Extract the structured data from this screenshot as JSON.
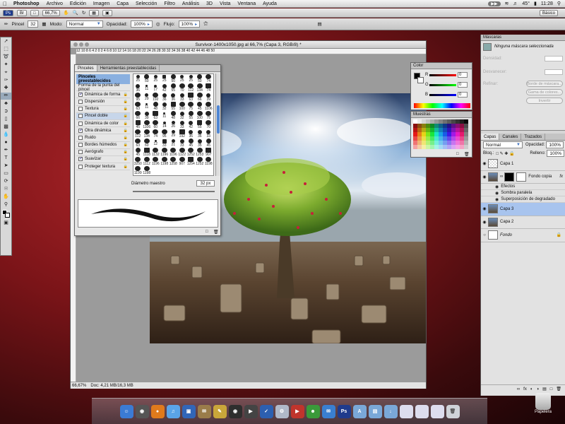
{
  "menubar": {
    "app": "Photoshop",
    "items": [
      "Archivo",
      "Edición",
      "Imagen",
      "Capa",
      "Selección",
      "Filtro",
      "Análisis",
      "3D",
      "Vista",
      "Ventana",
      "Ayuda"
    ],
    "battery": "45°",
    "clock": "11:28"
  },
  "appbar": {
    "zoom": "66,7%",
    "workspace": "Básico"
  },
  "options": {
    "tool": "Pincel",
    "brush_size": "32",
    "mode_label": "Modo:",
    "mode_value": "Normal",
    "opacity_label": "Opacidad:",
    "opacity_value": "100%",
    "flow_label": "Flujo:",
    "flow_value": "100%"
  },
  "document": {
    "title": "Survivor-1400x1050.jpg al 66,7% (Capa 3, RGB/8) *",
    "ruler_h": "12 10 8 6 4 2 0 2 4 6 8 10 12 14 16 18 20 22 24 26 28 30 32 34 36 38 40 42 44 46 48 50",
    "status_zoom": "66,67%",
    "status_doc": "Doc: 4,21 MB/16,3 MB"
  },
  "brushes": {
    "tabs": [
      "Pinceles",
      "Herramientas preestablecidas"
    ],
    "preset_button": "Pinceles preestablecidos",
    "tip_shape": "Forma de la punta del pincel",
    "options": [
      {
        "label": "Dinámica de forma",
        "checked": true
      },
      {
        "label": "Dispersión",
        "checked": false
      },
      {
        "label": "Textura",
        "checked": false
      },
      {
        "label": "Pincel doble",
        "checked": false
      },
      {
        "label": "Dinámica de color",
        "checked": false
      },
      {
        "label": "Otra dinámica",
        "checked": true
      },
      {
        "label": "Ruido",
        "checked": false
      },
      {
        "label": "Bordes húmedos",
        "checked": false
      },
      {
        "label": "Aerógrafo",
        "checked": false
      },
      {
        "label": "Suavizar",
        "checked": true
      },
      {
        "label": "Proteger textura",
        "checked": false
      }
    ],
    "sizes": [
      "25",
      "50",
      "25",
      "25",
      "50",
      "25",
      "25",
      "50",
      "74",
      "36",
      "11",
      "17",
      "42",
      "55",
      "70",
      "112",
      "134",
      "74",
      "95",
      "29",
      "192",
      "36",
      "36",
      "33",
      "63",
      "66",
      "39",
      "63",
      "11",
      "48",
      "32",
      "55",
      "100",
      "75",
      "45",
      "1106",
      "66",
      "39",
      "63",
      "11",
      "48",
      "32",
      "55",
      "100",
      "75",
      "45",
      "1106",
      "60",
      "14",
      "26",
      "33",
      "42",
      "55",
      "70",
      "112",
      "134",
      "74",
      "95",
      "29",
      "192",
      "36",
      "36",
      "33",
      "63",
      "60",
      "12",
      "33",
      "21",
      "33",
      "45",
      "35",
      "45",
      "45",
      "1118",
      "1132",
      "1196",
      "1196",
      "1122",
      "1252",
      "1253",
      "907",
      "3250",
      "1112",
      "1196",
      "1198",
      "1258",
      "907",
      "1254",
      "1252",
      "1198",
      "1199",
      "1198"
    ],
    "diameter_label": "Diámetro maestro",
    "diameter_value": "32 px"
  },
  "color_panel": {
    "title": "Color",
    "r": "0",
    "g": "0",
    "b": "0",
    "r_label": "R",
    "g_label": "G",
    "b_label": "B"
  },
  "swatches_panel": {
    "title": "Muestras"
  },
  "masks": {
    "title": "Máscaras",
    "none_selected": "Ninguna máscara seleccionada",
    "density": "Densidad:",
    "feather": "Desvanecer:",
    "refine": "Refinar:",
    "mask_edge": "Borde de máscara...",
    "color_range": "Gama de colores...",
    "invert": "Invertir"
  },
  "layers": {
    "tabs": [
      "Capas",
      "Canales",
      "Trazados"
    ],
    "blend": "Normal",
    "opacity_label": "Opacidad:",
    "opacity_value": "100%",
    "lock_label": "Bloq.:",
    "fill_label": "Relleno:",
    "fill_value": "100%",
    "items": [
      {
        "name": "Capa 1"
      },
      {
        "name": "Fondo copia"
      },
      {
        "name": "Capa 3"
      },
      {
        "name": "Capa 2"
      },
      {
        "name": "Fondo"
      }
    ],
    "effects_label": "Efectos",
    "effect1": "Sombra paralela",
    "effect2": "Superposición de degradado"
  },
  "dock": {
    "trash_label": "Papelera"
  }
}
